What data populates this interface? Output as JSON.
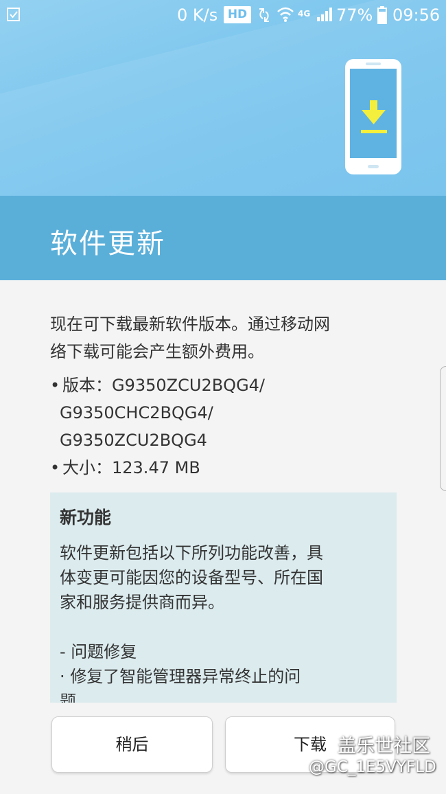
{
  "status_bar": {
    "net_speed": "0 K/s",
    "hd": "HD",
    "network": "4G",
    "battery": "77%",
    "time": "09:56",
    "icons": [
      "checklist-icon",
      "sync-icon",
      "wifi-icon",
      "signal-icon",
      "battery-icon"
    ]
  },
  "header": {
    "title": "软件更新",
    "illustration": "phone-download-icon",
    "colors": {
      "header_bg": "#7cc6ee",
      "title_bar": "#5aafd9",
      "arrow": "#f4ef3c"
    }
  },
  "content": {
    "description_lines": [
      "现在可下载最新软件版本。通过移动网",
      "络下载可能会产生额外费用。"
    ],
    "version_label": "版本：",
    "version_lines": [
      "G9350ZCU2BQG4/",
      "G9350CHC2BQG4/",
      "G9350ZCU2BQG4"
    ],
    "size_label": "大小：",
    "size_value": "123.47 MB",
    "bullet": "•"
  },
  "features": {
    "title": "新功能",
    "body_lines": [
      "软件更新包括以下所列功能改善，具",
      "体变更可能因您的设备型号、所在国",
      "家和服务提供商而异。"
    ],
    "fix_heading": "- 问题修复",
    "fix_lines": [
      "· 修复了智能管理器异常终止的问",
      "题。"
    ],
    "colors": {
      "box_bg": "#dcebee"
    }
  },
  "buttons": {
    "later": "稍后",
    "download": "下载"
  },
  "watermark": {
    "brand": "盖乐世社区",
    "user": "@GC_1E5VYFLD"
  }
}
